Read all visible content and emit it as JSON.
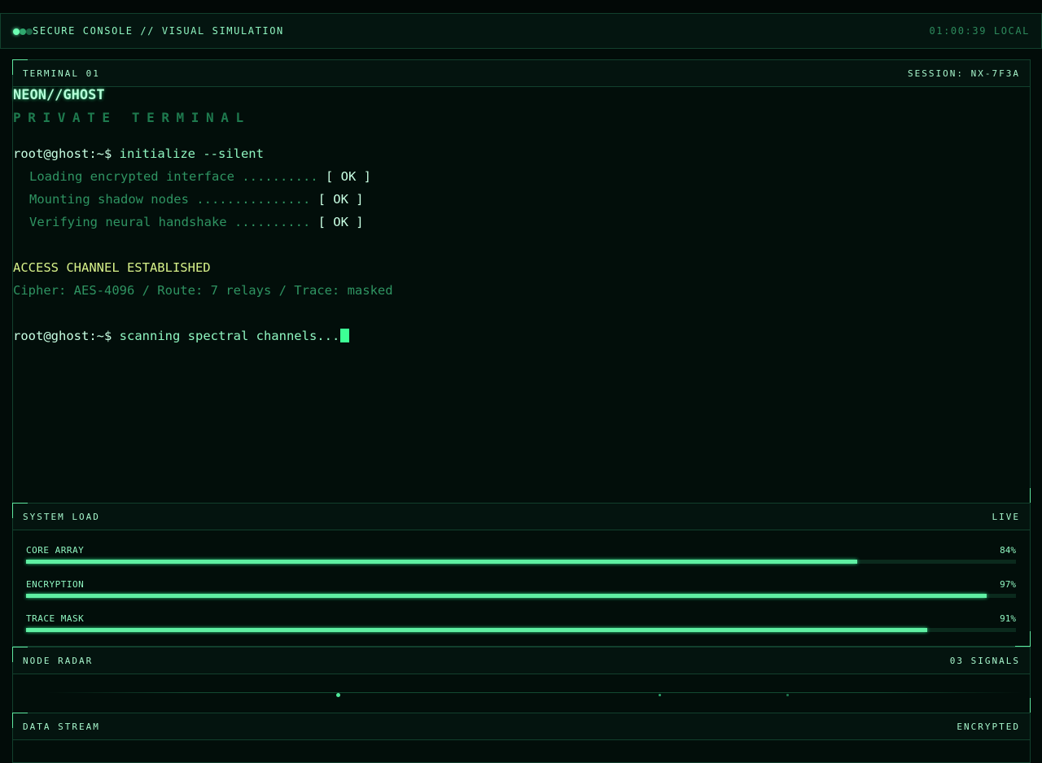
{
  "header": {
    "title": "SECURE CONSOLE // VISUAL SIMULATION",
    "clock": "01:00:39 LOCAL"
  },
  "terminal": {
    "label": "TERMINAL 01",
    "session": "SESSION: NX-7F3A",
    "brand": "NEON//GHOST",
    "subbrand": "PRIVATE TERMINAL",
    "prompt": "root@ghost:~$",
    "command1": "initialize --silent",
    "steps": [
      {
        "text": "Loading encrypted interface ..........",
        "status": "[ OK ]"
      },
      {
        "text": "Mounting shadow nodes ...............",
        "status": "[ OK ]"
      },
      {
        "text": "Verifying neural handshake ..........",
        "status": "[ OK ]"
      }
    ],
    "access": "ACCESS CHANNEL ESTABLISHED",
    "details": "Cipher: AES-4096 / Route: 7 relays / Trace: masked",
    "command2": "scanning spectral channels..."
  },
  "system_load": {
    "label": "SYSTEM LOAD",
    "status": "LIVE",
    "meters": [
      {
        "name": "CORE ARRAY",
        "value": "84%",
        "level": 0.84
      },
      {
        "name": "ENCRYPTION",
        "value": "97%",
        "level": 0.97
      },
      {
        "name": "TRACE MASK",
        "value": "91%",
        "level": 0.91
      }
    ]
  },
  "radar": {
    "label": "NODE RADAR",
    "signals": "03 SIGNALS"
  },
  "stream": {
    "label": "DATA STREAM",
    "status": "ENCRYPTED"
  },
  "colors": {
    "accent": "#5ff0a3",
    "warning": "#d8f28a",
    "background": "#020c09"
  }
}
